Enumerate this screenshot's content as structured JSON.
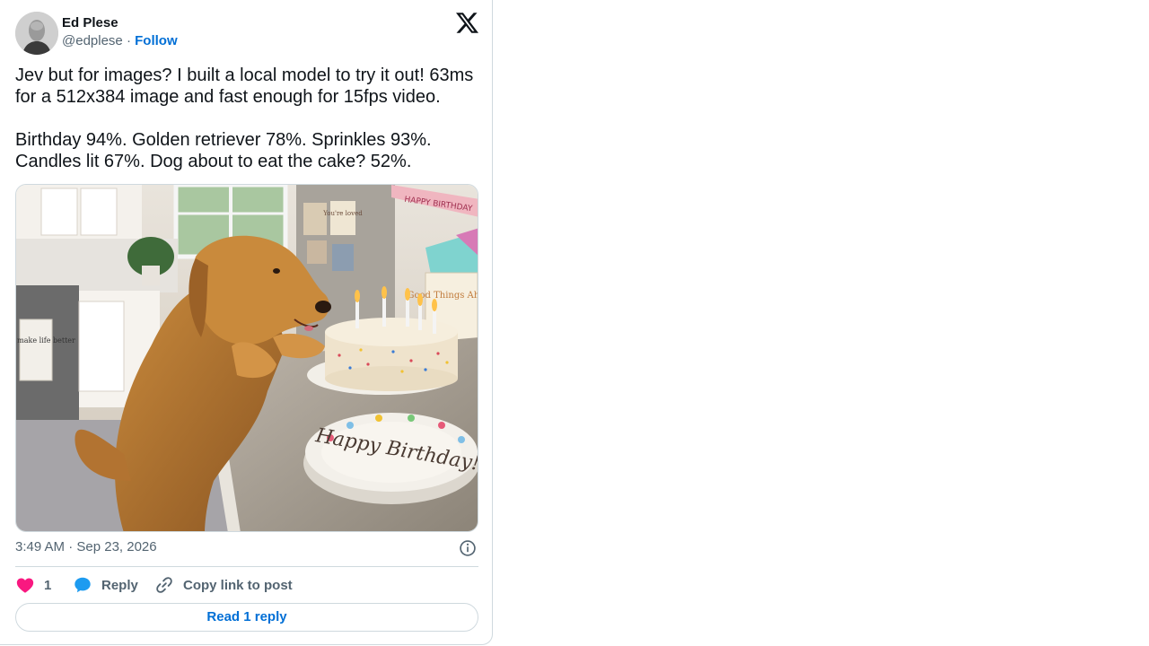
{
  "author": {
    "name": "Ed Plese",
    "handle": "@edplese",
    "separator": "·",
    "follow_label": "Follow"
  },
  "tweet": {
    "paragraphs": [
      "Jev but for images? I built a local model to try it out! 63ms for a 512x384 image and fast enough for 15fps video.",
      "Birthday 94%. Golden retriever 78%. Sprinkles 93%. Candles lit 67%. Dog about to eat the cake? 52%."
    ],
    "timestamp": "3:49 AM · Sep 23, 2026"
  },
  "photo": {
    "towel_text": "Dogs make life better",
    "plate_text": "Happy Birthday!",
    "card_text": "Good Things Ahead",
    "note_text": "You're loved",
    "banner_text": "HAPPY BIRTHDAY"
  },
  "actions": {
    "like_count": "1",
    "reply_label": "Reply",
    "copy_link_label": "Copy link to post"
  },
  "read_replies_label": "Read 1 reply",
  "colors": {
    "accent": "#006fd6",
    "like": "#f91880",
    "reply": "#1d9bf0",
    "muted": "#536471",
    "border": "#cfd9de"
  },
  "icons": {
    "platform": "x-logo-icon",
    "like": "heart-icon",
    "reply": "speech-bubble-icon",
    "copy": "link-icon",
    "info": "info-icon"
  }
}
